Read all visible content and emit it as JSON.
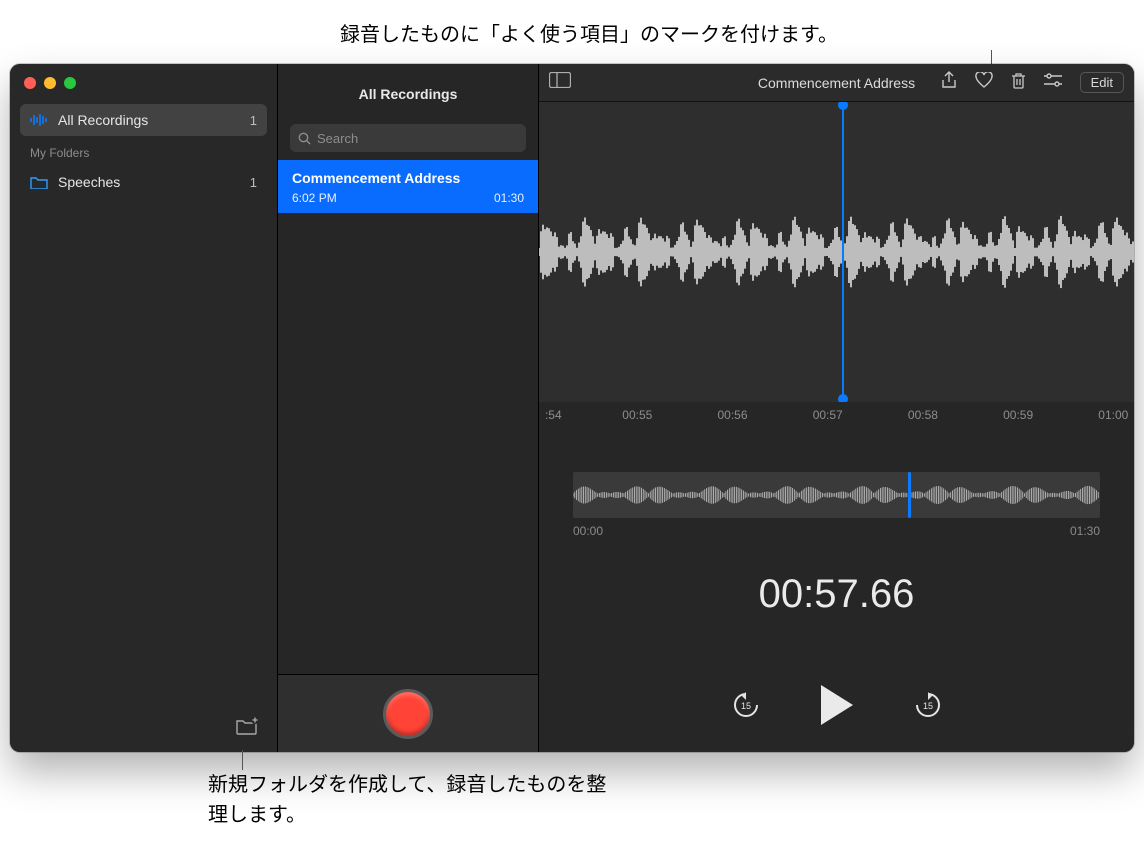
{
  "callouts": {
    "top": "録音したものに「よく使う項目」のマークを付けます。",
    "bottom": "新規フォルダを作成して、録音したものを整理します。"
  },
  "sidebar": {
    "all": {
      "label": "All Recordings",
      "count": "1"
    },
    "section": "My Folders",
    "folders": [
      {
        "label": "Speeches",
        "count": "1"
      }
    ]
  },
  "list": {
    "title": "All Recordings",
    "search_placeholder": "Search",
    "item": {
      "name": "Commencement Address",
      "time": "6:02 PM",
      "duration": "01:30"
    }
  },
  "toolbar": {
    "title": "Commencement Address",
    "edit": "Edit"
  },
  "ruler": {
    "t0": ":54",
    "t1": "00:55",
    "t2": "00:56",
    "t3": "00:57",
    "t4": "00:58",
    "t5": "00:59",
    "t6": "01:00"
  },
  "overview": {
    "start": "00:00",
    "end": "01:30"
  },
  "timecode": "00:57.66"
}
